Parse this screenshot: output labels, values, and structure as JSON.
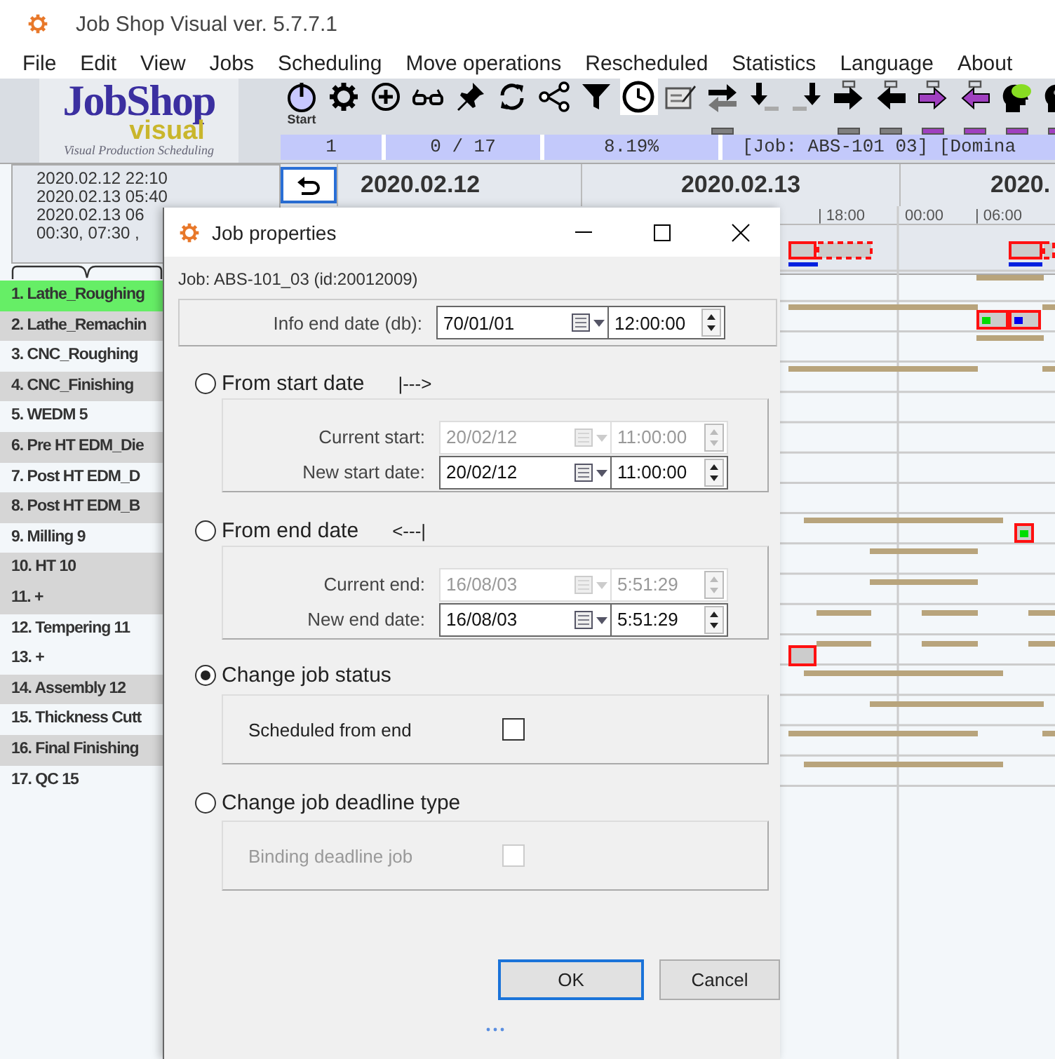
{
  "window": {
    "title": "Job Shop Visual ver. 5.7.7.1"
  },
  "menu": [
    "File",
    "Edit",
    "View",
    "Jobs",
    "Scheduling",
    "Move operations",
    "Rescheduled",
    "Statistics",
    "Language",
    "About"
  ],
  "logo": {
    "title": "JobShop",
    "subtitle": "visual",
    "tagline": "Visual Production Scheduling"
  },
  "toolbar": {
    "tools": [
      {
        "kind": "power",
        "label": "Start",
        "selected": false
      },
      {
        "kind": "gear",
        "selected": false
      },
      {
        "kind": "add",
        "selected": false
      },
      {
        "kind": "glasses",
        "selected": false
      },
      {
        "kind": "pin",
        "selected": false
      },
      {
        "kind": "sync",
        "selected": false
      },
      {
        "kind": "nodes",
        "selected": false
      },
      {
        "kind": "filter",
        "selected": false
      },
      {
        "kind": "clock",
        "selected": true
      },
      {
        "kind": "edit",
        "selected": false
      },
      {
        "kind": "swap",
        "selected": false,
        "color": "#808080"
      },
      {
        "kind": "down-left",
        "selected": false
      },
      {
        "kind": "down-right",
        "selected": false
      },
      {
        "kind": "move-right",
        "selected": false,
        "color": "#808080"
      },
      {
        "kind": "move-left",
        "selected": false,
        "color": "#808080"
      },
      {
        "kind": "shift-right",
        "selected": false,
        "color": "#a040c0"
      },
      {
        "kind": "shift-left",
        "selected": false,
        "color": "#a040c0"
      },
      {
        "kind": "head",
        "selected": false,
        "color": "#a040c0"
      },
      {
        "kind": "head-alt",
        "selected": false,
        "color": "#a040c0"
      }
    ]
  },
  "status_cells": [
    "1",
    "0 / 17",
    "8.19%",
    "[Job: ABS-101 03]  [Domina"
  ],
  "date_panel": {
    "lines": [
      "2020.02.12 22:10",
      "2020.02.13 05:40",
      "2020.02.13 06",
      "00:30, 07:30 ,"
    ]
  },
  "timeline": {
    "days": [
      "2020.02.12",
      "2020.02.13",
      "2020."
    ],
    "ticks": [
      "| 18:00",
      "00:00",
      "| 06:00"
    ]
  },
  "machines": [
    {
      "label": "1. Lathe_Roughing",
      "selected": true,
      "shaded": false
    },
    {
      "label": "2. Lathe_Remachin",
      "selected": false,
      "shaded": true
    },
    {
      "label": "3. CNC_Roughing",
      "selected": false,
      "shaded": false
    },
    {
      "label": "4. CNC_Finishing",
      "selected": false,
      "shaded": true
    },
    {
      "label": "5. WEDM 5",
      "selected": false,
      "shaded": false
    },
    {
      "label": "6. Pre HT EDM_Die",
      "selected": false,
      "shaded": true
    },
    {
      "label": "7. Post HT EDM_D",
      "selected": false,
      "shaded": false
    },
    {
      "label": "8. Post HT EDM_B",
      "selected": false,
      "shaded": true
    },
    {
      "label": "9. Milling 9",
      "selected": false,
      "shaded": false
    },
    {
      "label": "10. HT 10",
      "selected": false,
      "shaded": true
    },
    {
      "label": "11.   +",
      "selected": false,
      "shaded": true
    },
    {
      "label": "12. Tempering 11",
      "selected": false,
      "shaded": false
    },
    {
      "label": "13.   +",
      "selected": false,
      "shaded": false
    },
    {
      "label": "14. Assembly 12",
      "selected": false,
      "shaded": true
    },
    {
      "label": "15. Thickness Cutt",
      "selected": false,
      "shaded": false
    },
    {
      "label": "16. Final Finishing",
      "selected": false,
      "shaded": true
    },
    {
      "label": "17. QC 15",
      "selected": false,
      "shaded": false
    }
  ],
  "dialog": {
    "title": "Job properties",
    "job_line": "Job: ABS-101_03 (id:20012009)",
    "info_row": {
      "label": "Info end date (db):",
      "date": "70/01/01",
      "time": "12:00:00"
    },
    "options": [
      {
        "kind": "dates",
        "label": "From start date",
        "marker": "|--->",
        "selected": false,
        "rows": [
          {
            "label": "Current start:",
            "date": "20/02/12",
            "time": "11:00:00",
            "disabled": true
          },
          {
            "label": "New start date:",
            "date": "20/02/12",
            "time": "11:00:00",
            "disabled": false
          }
        ]
      },
      {
        "kind": "dates",
        "label": "From end date",
        "marker": "<---|",
        "selected": false,
        "rows": [
          {
            "label": "Current end:",
            "date": "16/08/03",
            "time": "5:51:29",
            "disabled": true
          },
          {
            "label": "New end date:",
            "date": "16/08/03",
            "time": "5:51:29",
            "disabled": false
          }
        ]
      },
      {
        "kind": "checkbox",
        "label": "Change job status",
        "selected": true,
        "checkbox": {
          "label": "Scheduled from end",
          "checked": false,
          "disabled": false
        }
      },
      {
        "kind": "checkbox",
        "label": "Change job deadline type",
        "selected": false,
        "checkbox": {
          "label": "Binding deadline job",
          "checked": false,
          "disabled": true
        }
      }
    ],
    "buttons": [
      {
        "label": "OK",
        "focused": true
      },
      {
        "label": "Cancel",
        "focused": false
      }
    ]
  }
}
